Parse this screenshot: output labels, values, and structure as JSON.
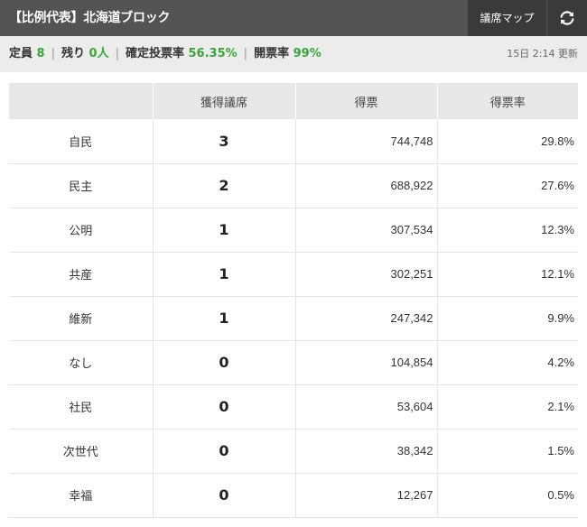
{
  "header": {
    "title": "【比例代表】北海道ブロック",
    "map_button_label": "議席マップ",
    "refresh_icon": "refresh-icon"
  },
  "stats": {
    "quota_label": "定員",
    "quota_value": "8",
    "remaining_label": "残り",
    "remaining_value": "0人",
    "turnout_label": "確定投票率",
    "turnout_value": "56.35%",
    "counted_label": "開票率",
    "counted_value": "99%",
    "updated": "15日 2:14 更新"
  },
  "table": {
    "headers": [
      "",
      "獲得議席",
      "得票",
      "得票率"
    ],
    "rows": [
      {
        "party": "自民",
        "seats": "3",
        "votes": "744,748",
        "rate": "29.8%"
      },
      {
        "party": "民主",
        "seats": "2",
        "votes": "688,922",
        "rate": "27.6%"
      },
      {
        "party": "公明",
        "seats": "1",
        "votes": "307,534",
        "rate": "12.3%"
      },
      {
        "party": "共産",
        "seats": "1",
        "votes": "302,251",
        "rate": "12.1%"
      },
      {
        "party": "維新",
        "seats": "1",
        "votes": "247,342",
        "rate": "9.9%"
      },
      {
        "party": "なし",
        "seats": "0",
        "votes": "104,854",
        "rate": "4.2%"
      },
      {
        "party": "社民",
        "seats": "0",
        "votes": "53,604",
        "rate": "2.1%"
      },
      {
        "party": "次世代",
        "seats": "0",
        "votes": "38,342",
        "rate": "1.5%"
      },
      {
        "party": "幸福",
        "seats": "0",
        "votes": "12,267",
        "rate": "0.5%"
      }
    ]
  },
  "colors": {
    "header_bg": "#535353",
    "button_bg": "#3a3a3a",
    "stats_bg": "#ececec",
    "accent_green": "#3aa63a"
  }
}
